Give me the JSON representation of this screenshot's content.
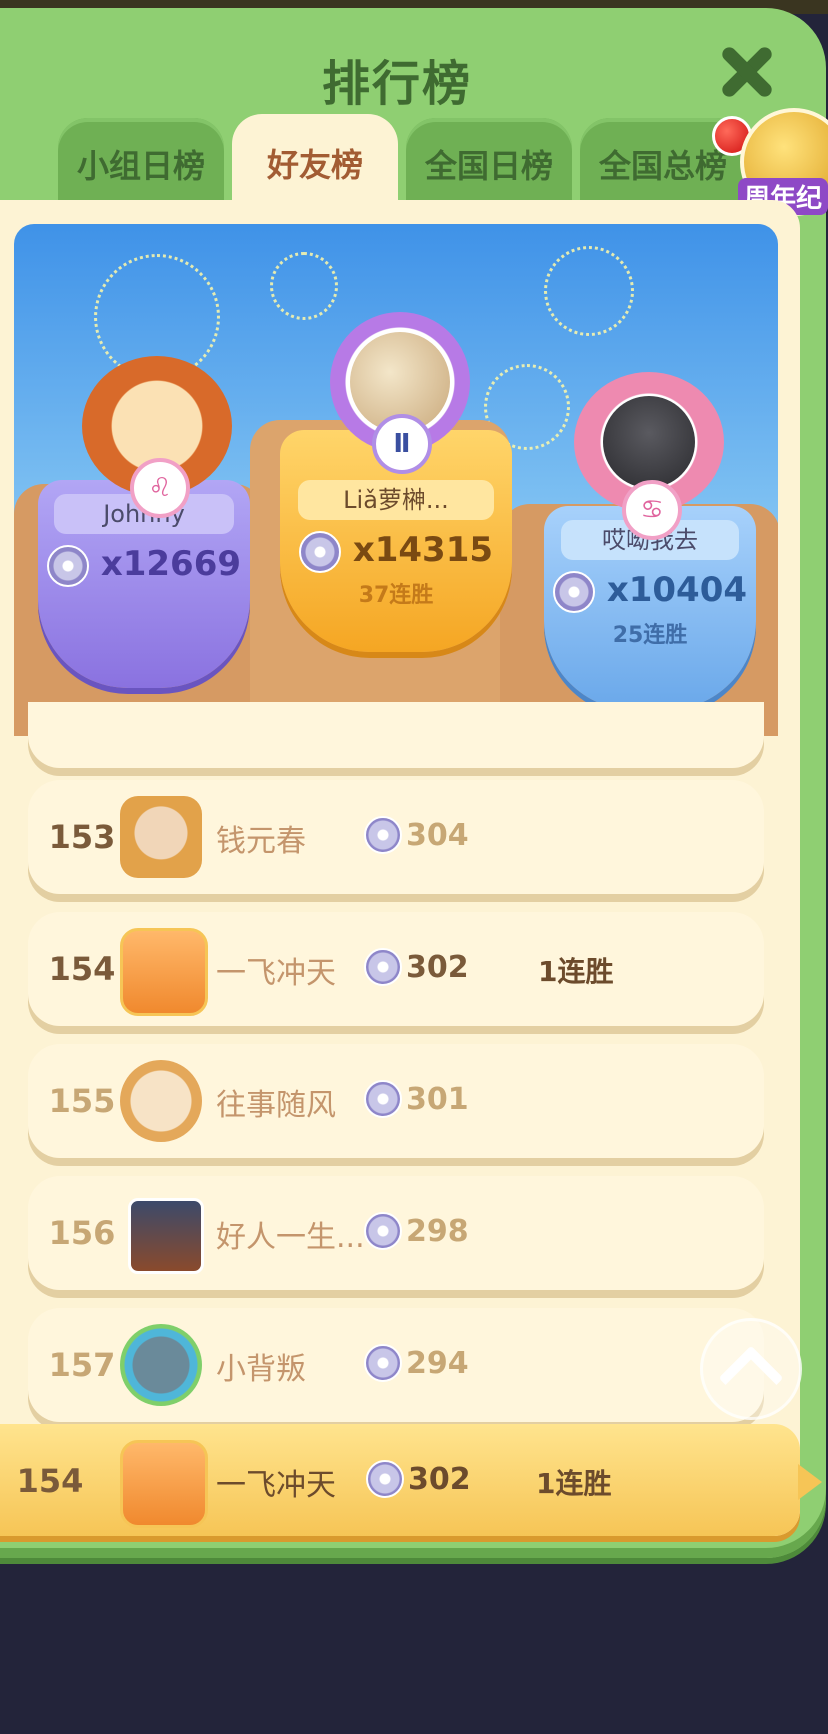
{
  "header": {
    "title": "排行榜"
  },
  "tabs": [
    {
      "label": "小组日榜"
    },
    {
      "label": "好友榜"
    },
    {
      "label": "全国日榜"
    },
    {
      "label": "全国总榜"
    }
  ],
  "event_badge": {
    "label": "周年纪"
  },
  "podium": {
    "second": {
      "name": "Johnny",
      "score": "x12669",
      "zodiac": "♌"
    },
    "first": {
      "name": "Liǎ萝榊...",
      "score": "x14315",
      "streak": "37连胜",
      "zodiac": "Ⅱ"
    },
    "third": {
      "name": "哎呦我去",
      "score": "x10404",
      "streak": "25连胜",
      "zodiac": "♋"
    }
  },
  "rows": [
    {
      "rank": "153",
      "name": "钱元春",
      "score": "304",
      "streak": ""
    },
    {
      "rank": "154",
      "name": "一飞冲天",
      "score": "302",
      "streak": "1连胜"
    },
    {
      "rank": "155",
      "name": "往事随风",
      "score": "301",
      "streak": ""
    },
    {
      "rank": "156",
      "name": "好人一生...",
      "score": "298",
      "streak": ""
    },
    {
      "rank": "157",
      "name": "小背叛",
      "score": "294",
      "streak": ""
    }
  ],
  "self": {
    "rank": "154",
    "name": "一飞冲天",
    "score": "302",
    "streak": "1连胜"
  },
  "colors": {
    "panel": "#8fcf72",
    "tab_active": "#fdf3d4",
    "gold": "#f6c556",
    "purple": "#8f78e6",
    "blue": "#6aa8ea"
  }
}
